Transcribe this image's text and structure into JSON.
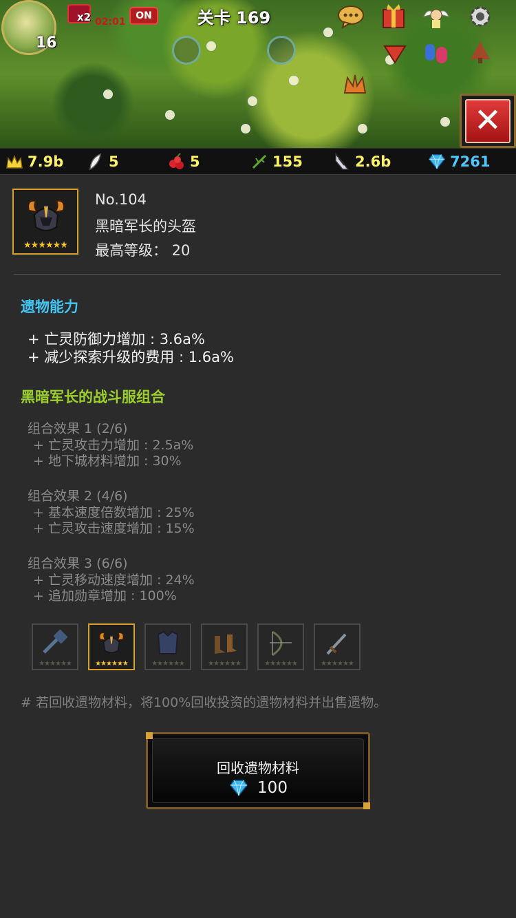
{
  "hud": {
    "level": "16",
    "speed_label": "x2",
    "timer": "02:01",
    "auto_toggle": "ON",
    "stage_title": "关卡 169",
    "close_symbol": "✕"
  },
  "resources": {
    "crown": "7.9b",
    "feather": "5",
    "berries": "5",
    "twig": "155",
    "wing": "2.6b",
    "gems": "7261"
  },
  "item": {
    "number": "No.104",
    "name": "黑暗军长的头盔",
    "max_level": "最高等级： 20",
    "stars": "★★★★★★"
  },
  "abilities": {
    "title": "遗物能力",
    "lines": [
      "+ 亡灵防御力增加 : 3.6a%",
      "+ 减少探索升级的费用 : 1.6a%"
    ]
  },
  "set": {
    "title": "黑暗军长的战斗服组合",
    "effects": [
      {
        "head": "组合效果 1 (2/6)",
        "lines": [
          "+ 亡灵攻击力增加 : 2.5a%",
          "+ 地下城材料增加 : 30%"
        ]
      },
      {
        "head": "组合效果 2 (4/6)",
        "lines": [
          "+ 基本速度倍数增加 : 25%",
          "+ 亡灵攻击速度增加 : 15%"
        ]
      },
      {
        "head": "组合效果 3 (6/6)",
        "lines": [
          "+ 亡灵移动速度增加 : 24%",
          "+ 追加勋章增加 : 100%"
        ]
      }
    ],
    "slots_stars": "★★★★★★"
  },
  "note": "# 若回收遗物材料，将100%回收投资的遗物材料并出售遗物。",
  "recycle": {
    "label": "回收遗物材料",
    "cost": "100"
  },
  "colors": {
    "accent_blue": "#42c6f5",
    "accent_green": "#9ccf2a",
    "gold_border": "#d7a12b",
    "resource_yellow": "#fff36a",
    "close_red": "#c92424"
  },
  "icons": [
    "crown-icon",
    "feather-icon",
    "berries-icon",
    "twig-icon",
    "wing-icon",
    "gem-icon",
    "chat-icon",
    "gift-icon",
    "angel-icon",
    "gear-icon",
    "close-icon"
  ]
}
